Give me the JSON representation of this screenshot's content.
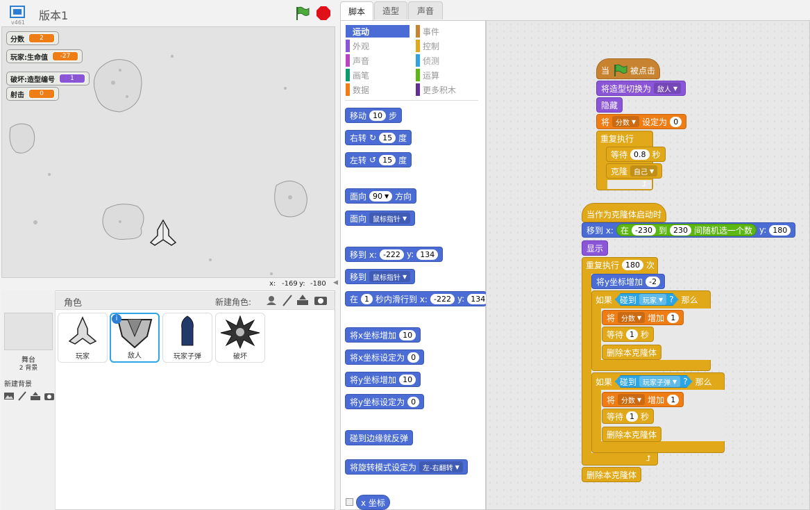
{
  "app": {
    "title": "版本1",
    "version": "v461"
  },
  "monitors": [
    {
      "label": "分数",
      "value": "2",
      "color": "orange"
    },
    {
      "label": "玩家:生命值",
      "value": "-27",
      "color": "orange"
    },
    {
      "label": "破坏:造型编号",
      "value": "1",
      "color": "purple"
    },
    {
      "label": "射击",
      "value": "0",
      "color": "orange"
    }
  ],
  "stage_coords": {
    "x_label": "x:",
    "x": "-169",
    "y_label": "y:",
    "y": "-180"
  },
  "sprite_panel": {
    "title": "角色",
    "new_sprite": "新建角色:",
    "stage_label": "舞台",
    "stage_backdrops": "2 背景",
    "new_backdrop": "新建背景",
    "sprites": [
      "玩家",
      "敌人",
      "玩家子弹",
      "破坏"
    ]
  },
  "tabs": [
    "脚本",
    "造型",
    "声音"
  ],
  "categories": [
    {
      "label": "运动",
      "color": "#4a6cd4"
    },
    {
      "label": "事件",
      "color": "#c88330"
    },
    {
      "label": "外观",
      "color": "#8a55d7"
    },
    {
      "label": "控制",
      "color": "#e1a91a"
    },
    {
      "label": "声音",
      "color": "#bb42c3"
    },
    {
      "label": "侦测",
      "color": "#2ca5e2"
    },
    {
      "label": "画笔",
      "color": "#0e9a6c"
    },
    {
      "label": "运算",
      "color": "#5cb712"
    },
    {
      "label": "数据",
      "color": "#ee7d16"
    },
    {
      "label": "更多积木",
      "color": "#632d99"
    }
  ],
  "palette_blocks": {
    "move": {
      "a": "移动",
      "n": "10",
      "b": "步"
    },
    "turn_right": {
      "a": "右转",
      "n": "15",
      "b": "度"
    },
    "turn_left": {
      "a": "左转",
      "n": "15",
      "b": "度"
    },
    "point_dir": {
      "a": "面向",
      "n": "90",
      "b": "方向"
    },
    "point_towards": {
      "a": "面向",
      "d": "鼠标指针"
    },
    "goto_xy": {
      "a": "移到 x:",
      "x": "-222",
      "yl": "y:",
      "y": "134"
    },
    "goto": {
      "a": "移到",
      "d": "鼠标指针"
    },
    "glide": {
      "a": "在",
      "n": "1",
      "b": "秒内滑行到 x:",
      "x": "-222",
      "yl": "y:",
      "y": "134"
    },
    "change_x": {
      "a": "将x坐标增加",
      "n": "10"
    },
    "set_x": {
      "a": "将x坐标设定为",
      "n": "0"
    },
    "change_y": {
      "a": "将y坐标增加",
      "n": "10"
    },
    "set_y": {
      "a": "将y坐标设定为",
      "n": "0"
    },
    "bounce": {
      "a": "碰到边缘就反弹"
    },
    "rotation": {
      "a": "将旋转模式设定为",
      "d": "左-右翻转"
    },
    "xpos": {
      "a": "x 坐标"
    }
  },
  "script1": {
    "hat_a": "当",
    "hat_b": "被点击",
    "switch": {
      "a": "将造型切换为",
      "d": "敌人"
    },
    "hide": "隐藏",
    "setvar": {
      "a": "将",
      "d": "分数",
      "b": "设定为",
      "n": "0"
    },
    "forever": "重复执行",
    "wait": {
      "a": "等待",
      "n": "0.8",
      "b": "秒"
    },
    "clone": {
      "a": "克隆",
      "d": "自己"
    }
  },
  "script2": {
    "hat": "当作为克隆体启动时",
    "goto": {
      "a": "移到 x:",
      "r1": "在",
      "n1": "-230",
      "r2": "到",
      "n2": "230",
      "r3": "间随机选一个数",
      "yl": "y:",
      "y": "180"
    },
    "show": "显示",
    "repeat": {
      "a": "重复执行",
      "n": "180",
      "b": "次"
    },
    "change_y": {
      "a": "将y坐标增加",
      "n": "-2"
    },
    "if1": {
      "a": "如果",
      "s": "碰到",
      "d": "玩家",
      "q": "?",
      "b": "那么"
    },
    "change1": {
      "a": "将",
      "d": "分数",
      "b": "增加",
      "n": "1"
    },
    "wait1": {
      "a": "等待",
      "n": "1",
      "b": "秒"
    },
    "delete1": "删除本克隆体",
    "if2": {
      "a": "如果",
      "s": "碰到",
      "d": "玩家子弹",
      "q": "?",
      "b": "那么"
    },
    "change2": {
      "a": "将",
      "d": "分数",
      "b": "增加",
      "n": "1"
    },
    "wait2": {
      "a": "等待",
      "n": "1",
      "b": "秒"
    },
    "delete2": "删除本克隆体",
    "delete3": "删除本克隆体"
  }
}
